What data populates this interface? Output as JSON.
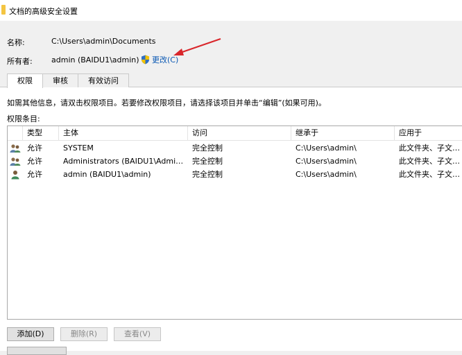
{
  "window": {
    "title": "文档的高级安全设置"
  },
  "fields": {
    "name_label": "名称:",
    "name_value": "C:\\Users\\admin\\Documents",
    "owner_label": "所有者:",
    "owner_value": "admin (BAIDU1\\admin)",
    "change_link": "更改(C)"
  },
  "tabs": [
    {
      "label": "权限",
      "active": true
    },
    {
      "label": "审核",
      "active": false
    },
    {
      "label": "有效访问",
      "active": false
    }
  ],
  "info_text": "如需其他信息，请双击权限项目。若要修改权限项目，请选择该项目并单击“编辑”(如果可用)。",
  "list_label": "权限条目:",
  "columns": [
    "类型",
    "主体",
    "访问",
    "继承于",
    "应用于"
  ],
  "entries": [
    {
      "icon": "group-users-icon",
      "type": "允许",
      "principal": "SYSTEM",
      "access": "完全控制",
      "inherited": "C:\\Users\\admin\\",
      "applies": "此文件夹、子文件夹"
    },
    {
      "icon": "group-users-icon",
      "type": "允许",
      "principal": "Administrators (BAIDU1\\Adminis...",
      "access": "完全控制",
      "inherited": "C:\\Users\\admin\\",
      "applies": "此文件夹、子文件夹"
    },
    {
      "icon": "single-user-icon",
      "type": "允许",
      "principal": "admin (BAIDU1\\admin)",
      "access": "完全控制",
      "inherited": "C:\\Users\\admin\\",
      "applies": "此文件夹、子文件夹"
    }
  ],
  "buttons": {
    "add": "添加(D)",
    "remove": "删除(R)",
    "view": "查看(V)"
  },
  "colors": {
    "link": "#0a58b3",
    "annotation_arrow": "#d9262b"
  }
}
